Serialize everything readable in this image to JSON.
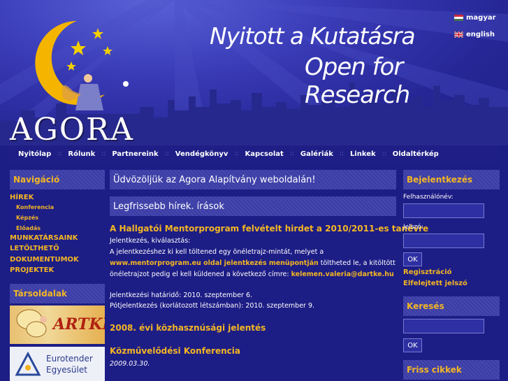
{
  "header": {
    "logo_text": "AGORA",
    "tagline_hu": "Nyitott a Kutatásra",
    "tagline_en": "Open for Research",
    "languages": [
      {
        "label": "magyar",
        "flag": "hungary-flag-icon"
      },
      {
        "label": "english",
        "flag": "uk-flag-icon"
      }
    ]
  },
  "nav": {
    "items": [
      "Nyitólap",
      "Rólunk",
      "Partnereink",
      "Vendégkönyv",
      "Kapcsolat",
      "Galériák",
      "Linkek",
      "Oldaltérkép"
    ],
    "separator": "::"
  },
  "sidebar": {
    "nav_title": "Navigáció",
    "items": [
      {
        "label": "HÍREK",
        "level": 0
      },
      {
        "label": "Konferencia",
        "level": 1
      },
      {
        "label": "Képzés",
        "level": 1
      },
      {
        "label": "Előadás",
        "level": 1
      },
      {
        "label": "MUNKATÁRSAINK",
        "level": 0
      },
      {
        "label": "LETÖLTHETŐ",
        "level": 0
      },
      {
        "label": "DOKUMENTUMOK",
        "level": 0
      },
      {
        "label": "PROJEKTEK",
        "level": 0
      }
    ],
    "partners_title": "Társoldalak",
    "banners": [
      {
        "label": "ARTKE"
      },
      {
        "label_line1": "Eurotender",
        "label_line2": "Egyesület"
      }
    ]
  },
  "main": {
    "welcome": "Üdvözöljük az Agora Alapítvány weboldalán!",
    "news_title": "Legfrissebb hírek. írások",
    "article1": {
      "title": "A Hallgatói Mentorprogram felvételt hirdet a 2010/2011-es tanévre",
      "l1": "Jelentkezés, kiválasztás:",
      "l2": "A jelentkezéshez ki kell töltened egy önéletrajz-mintát, melyet a",
      "l3a": "www.mentorprogram.eu oldal jelentkezés menüpontján",
      "l3b": " töltheted le, a kitöltött",
      "l4a": "önéletrajzot pedig el kell küldened a következő címre: ",
      "l4b": "kelemen.valeria@dartke.hu",
      "l5": "Jelentkezési határidő: 2010. szeptember 6.",
      "l6": "Pótjelentkezés (korlátozott létszámban): 2010. szeptember 9."
    },
    "article2_title": "2008. évi közhasznúsági jelentés",
    "article3": {
      "title": "Közművelődési Konferencia",
      "date": "2009.03.30."
    }
  },
  "right": {
    "login_title": "Bejelentkezés",
    "username_label": "Felhasználónév:",
    "password_label": "Jelszó:",
    "ok": "OK",
    "register": "Regisztráció",
    "forgot": "Elfelejtett jelszó",
    "search_title": "Keresés",
    "search_ok": "OK",
    "fresh_title": "Friss cikkek"
  },
  "colors": {
    "accent": "#f3b623",
    "background": "#1d1d86",
    "panel": "#3b3da4"
  }
}
